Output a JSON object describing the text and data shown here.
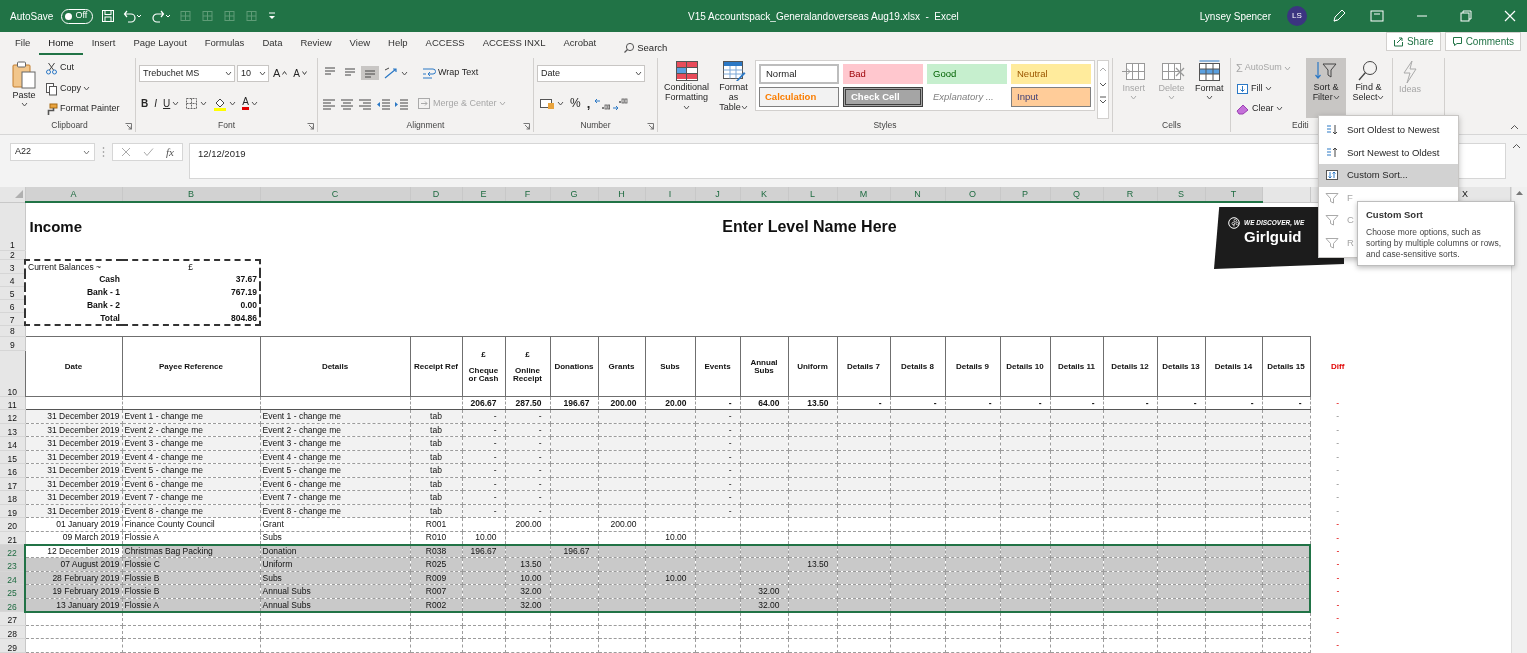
{
  "title_bar": {
    "autosave_label": "AutoSave",
    "autosave": {
      "label": "Off",
      "on": false
    },
    "document_title": "V15 Accountspack_Generalandoverseas Aug19.xlsx  -  Excel",
    "user_name": "Lynsey Spencer",
    "user_initials": "LS"
  },
  "ribbon_tabs": [
    {
      "label": "File",
      "selected": false
    },
    {
      "label": "Home",
      "selected": true
    },
    {
      "label": "Insert",
      "selected": false
    },
    {
      "label": "Page Layout",
      "selected": false
    },
    {
      "label": "Formulas",
      "selected": false
    },
    {
      "label": "Data",
      "selected": false
    },
    {
      "label": "Review",
      "selected": false
    },
    {
      "label": "View",
      "selected": false
    },
    {
      "label": "Help",
      "selected": false
    },
    {
      "label": "ACCESS",
      "selected": false
    },
    {
      "label": "ACCESS INXL",
      "selected": false
    },
    {
      "label": "Acrobat",
      "selected": false
    }
  ],
  "search_label": "Search",
  "share_label": "Share",
  "comments_label": "Comments",
  "ribbon": {
    "clipboard": {
      "label": "Clipboard",
      "paste": "Paste",
      "cut": "Cut",
      "copy": "Copy",
      "format_painter": "Format Painter"
    },
    "font": {
      "label": "Font",
      "font_name": "Trebuchet MS",
      "font_size": "10",
      "grow_font": "A",
      "shrink_font": "A",
      "bold": "B",
      "italic": "I",
      "underline": "U",
      "font_color": "A"
    },
    "alignment": {
      "label": "Alignment",
      "vertical_align": [
        {
          "selected": false
        },
        {
          "selected": false
        },
        {
          "selected": true
        }
      ],
      "wrap_text": "Wrap Text",
      "merge_center": {
        "label": "Merge & Center",
        "disabled": true
      }
    },
    "number": {
      "label": "Number",
      "format": "Date",
      "percent": "%",
      "comma": ","
    },
    "styles": {
      "label": "Styles",
      "conditional_formatting": "Conditional Formatting",
      "format_as_table": "Format as Table",
      "cell_styles": [
        {
          "label": "Normal",
          "kind": "normal"
        },
        {
          "label": "Bad",
          "kind": "bad"
        },
        {
          "label": "Good",
          "kind": "good"
        },
        {
          "label": "Neutral",
          "kind": "neutral"
        },
        {
          "label": "Calculation",
          "kind": "calculation"
        },
        {
          "label": "Check Cell",
          "kind": "check"
        },
        {
          "label": "Explanatory ...",
          "kind": "explanatory"
        },
        {
          "label": "Input",
          "kind": "input"
        }
      ]
    },
    "cells": {
      "label": "Cells",
      "buttons": [
        {
          "label": "Insert",
          "kind": "insert",
          "disabled": true
        },
        {
          "label": "Delete",
          "kind": "delete",
          "disabled": true
        },
        {
          "label": "Format",
          "kind": "format",
          "disabled": false
        }
      ]
    },
    "editing": {
      "label": "Editi",
      "autosum": {
        "symbol": "Σ",
        "label": "AutoSum",
        "disabled": true
      },
      "fill": "Fill",
      "clear": "Clear",
      "sort_filter": {
        "label": "Sort & Filter",
        "expanded": true
      },
      "find_select": "Find & Select"
    },
    "ideas": {
      "label": "Ideas",
      "disabled": true
    }
  },
  "sort_menu": {
    "items": [
      {
        "label": "Sort Oldest to Newest",
        "kind": "sort_ascending",
        "disabled": false,
        "selected": false
      },
      {
        "label": "Sort Newest to Oldest",
        "kind": "sort_descending",
        "disabled": false,
        "selected": false
      },
      {
        "label": "Custom Sort...",
        "kind": "custom",
        "disabled": false,
        "selected": true
      },
      {
        "label": "F",
        "kind": "filter",
        "disabled": true,
        "selected": false
      },
      {
        "label": "C",
        "kind": "clear_filter",
        "disabled": true,
        "selected": false
      },
      {
        "label": "R",
        "kind": "reapply",
        "disabled": true,
        "selected": false
      }
    ]
  },
  "tooltip": {
    "title": "Custom Sort",
    "text": "Choose more options, such as sorting by multiple columns or rows, and case-sensitive sorts."
  },
  "formula_bar": {
    "name_box": "A22",
    "function_symbol": "fx",
    "formula": "12/12/2019"
  },
  "sheet": {
    "column_headers": [
      {
        "kind": "letter",
        "letter": "A",
        "selected": true
      },
      {
        "kind": "letter",
        "letter": "B",
        "selected": true
      },
      {
        "kind": "letter",
        "letter": "C",
        "selected": true
      },
      {
        "kind": "letter",
        "letter": "D",
        "selected": true
      },
      {
        "kind": "letter",
        "letter": "E",
        "selected": true
      },
      {
        "kind": "letter",
        "letter": "F",
        "selected": true
      },
      {
        "kind": "letter",
        "letter": "G",
        "selected": true
      },
      {
        "kind": "letter",
        "letter": "H",
        "selected": true
      },
      {
        "kind": "letter",
        "letter": "I",
        "selected": true
      },
      {
        "kind": "letter",
        "letter": "J",
        "selected": true
      },
      {
        "kind": "letter",
        "letter": "K",
        "selected": true
      },
      {
        "kind": "letter",
        "letter": "L",
        "selected": true
      },
      {
        "kind": "letter",
        "letter": "M",
        "selected": true
      },
      {
        "kind": "letter",
        "letter": "N",
        "selected": true
      },
      {
        "kind": "letter",
        "letter": "O",
        "selected": true
      },
      {
        "kind": "letter",
        "letter": "P",
        "selected": true
      },
      {
        "kind": "letter",
        "letter": "Q",
        "selected": true
      },
      {
        "kind": "letter",
        "letter": "R",
        "selected": true
      },
      {
        "kind": "letter",
        "letter": "S",
        "selected": true
      },
      {
        "kind": "letter",
        "letter": "T",
        "selected": true
      },
      {
        "kind": "covered"
      },
      {
        "kind": "covered"
      },
      {
        "kind": "covered"
      },
      {
        "kind": "letter",
        "letter": "X",
        "selected": false
      }
    ],
    "row_numbers": [
      "1",
      "2",
      "3",
      "4",
      "5",
      "6",
      "7",
      "8",
      "9",
      "10",
      "11",
      "12",
      "13",
      "14",
      "15",
      "16",
      "17",
      "18",
      "19",
      "20",
      "21",
      "22",
      "23",
      "24",
      "25",
      "26",
      "27",
      "28",
      "29"
    ],
    "title": "Income",
    "heading": "Enter Level Name Here",
    "logo": {
      "tagline": "WE DISCOVER, WE",
      "name": "Girlguid"
    },
    "balances": {
      "title": "Current Balances ~",
      "currency": "£",
      "items": [
        {
          "label": "Cash",
          "value": "37.67"
        },
        {
          "label": "Bank - 1",
          "value": "767.19"
        },
        {
          "label": "Bank - 2",
          "value": "0.00"
        },
        {
          "label": "Total",
          "value": "804.86"
        }
      ]
    },
    "headers": [
      {
        "label": "Date",
        "kind": "column"
      },
      {
        "label": "Payee Reference",
        "kind": "column"
      },
      {
        "label": "Details",
        "kind": "column"
      },
      {
        "label": "Receipt Ref",
        "kind": "column"
      },
      {
        "label": "Cheque or Cash",
        "currency": "£",
        "kind": "column"
      },
      {
        "label": "Online Receipt",
        "currency": "£",
        "kind": "column"
      },
      {
        "label": "Donations",
        "kind": "column"
      },
      {
        "label": "Grants",
        "kind": "column"
      },
      {
        "label": "Subs",
        "kind": "column"
      },
      {
        "label": "Events",
        "kind": "column"
      },
      {
        "label": "Annual Subs",
        "kind": "column"
      },
      {
        "label": "Uniform",
        "kind": "column"
      },
      {
        "label": "Details 7",
        "kind": "column"
      },
      {
        "label": "Details 8",
        "kind": "column"
      },
      {
        "label": "Details 9",
        "kind": "column"
      },
      {
        "label": "Details 10",
        "kind": "column"
      },
      {
        "label": "Details 11",
        "kind": "column"
      },
      {
        "label": "Details 12",
        "kind": "column"
      },
      {
        "label": "Details 13",
        "kind": "column"
      },
      {
        "label": "Details 14",
        "kind": "column"
      },
      {
        "label": "Details 15",
        "kind": "column"
      },
      {
        "label": "Diff",
        "kind": "diff"
      }
    ],
    "totals": [
      "206.67",
      "287.50",
      "196.67",
      "200.00",
      "20.00",
      "-",
      "64.00",
      "13.50",
      "-",
      "-",
      "-",
      "-",
      "-",
      "-",
      "-",
      "-",
      "-"
    ],
    "totals_diff": {
      "value": "-",
      "alert": true
    },
    "entries": [
      {
        "kind": "template",
        "date": "31 December 2019",
        "payee": "Event 1 - change me",
        "details": "Event 1 - change me",
        "ref": "tab",
        "values": {
          "cheque_or_cash": "-",
          "online_receipt": "-",
          "events": "-"
        },
        "diff": "-",
        "diff_alert": false,
        "selected": false,
        "active": false
      },
      {
        "kind": "template",
        "date": "31 December 2019",
        "payee": "Event 2 - change me",
        "details": "Event 2 - change me",
        "ref": "tab",
        "values": {
          "cheque_or_cash": "-",
          "online_receipt": "-",
          "events": "-"
        },
        "diff": "-",
        "diff_alert": false,
        "selected": false,
        "active": false
      },
      {
        "kind": "template",
        "date": "31 December 2019",
        "payee": "Event 3 - change me",
        "details": "Event 3 - change me",
        "ref": "tab",
        "values": {
          "cheque_or_cash": "-",
          "online_receipt": "-",
          "events": "-"
        },
        "diff": "-",
        "diff_alert": false,
        "selected": false,
        "active": false
      },
      {
        "kind": "template",
        "date": "31 December 2019",
        "payee": "Event 4 - change me",
        "details": "Event 4 - change me",
        "ref": "tab",
        "values": {
          "cheque_or_cash": "-",
          "online_receipt": "-",
          "events": "-"
        },
        "diff": "-",
        "diff_alert": false,
        "selected": false,
        "active": false
      },
      {
        "kind": "template",
        "date": "31 December 2019",
        "payee": "Event 5 - change me",
        "details": "Event 5 - change me",
        "ref": "tab",
        "values": {
          "cheque_or_cash": "-",
          "online_receipt": "-",
          "events": "-"
        },
        "diff": "-",
        "diff_alert": false,
        "selected": false,
        "active": false
      },
      {
        "kind": "template",
        "date": "31 December 2019",
        "payee": "Event 6 - change me",
        "details": "Event 6 - change me",
        "ref": "tab",
        "values": {
          "cheque_or_cash": "-",
          "online_receipt": "-",
          "events": "-"
        },
        "diff": "-",
        "diff_alert": false,
        "selected": false,
        "active": false
      },
      {
        "kind": "template",
        "date": "31 December 2019",
        "payee": "Event 7 - change me",
        "details": "Event 7 - change me",
        "ref": "tab",
        "values": {
          "cheque_or_cash": "-",
          "online_receipt": "-",
          "events": "-"
        },
        "diff": "-",
        "diff_alert": false,
        "selected": false,
        "active": false
      },
      {
        "kind": "template",
        "date": "31 December 2019",
        "payee": "Event 8 - change me",
        "details": "Event 8 - change me",
        "ref": "tab",
        "values": {
          "cheque_or_cash": "-",
          "online_receipt": "-",
          "events": "-"
        },
        "diff": "-",
        "diff_alert": false,
        "selected": false,
        "active": false
      },
      {
        "kind": "entry",
        "date": "01 January 2019",
        "payee": "Finance County Council",
        "details": "Grant",
        "ref": "R001",
        "values": {
          "online_receipt": "200.00",
          "grants": "200.00"
        },
        "diff": "-",
        "diff_alert": true,
        "selected": false,
        "active": false
      },
      {
        "kind": "entry",
        "date": "09 March 2019",
        "payee": "Flossie A",
        "details": "Subs",
        "ref": "R010",
        "values": {
          "cheque_or_cash": "10.00",
          "subs": "10.00"
        },
        "diff": "-",
        "diff_alert": true,
        "selected": false,
        "active": false
      },
      {
        "kind": "entry",
        "date": "12 December 2019",
        "payee": "Christmas Bag Packing",
        "details": "Donation",
        "ref": "R038",
        "values": {
          "cheque_or_cash": "196.67",
          "donations": "196.67"
        },
        "diff": "-",
        "diff_alert": true,
        "selected": true,
        "active": true
      },
      {
        "kind": "entry",
        "date": "07 August 2019",
        "payee": "Flossie C",
        "details": "Uniform",
        "ref": "R025",
        "values": {
          "online_receipt": "13.50",
          "uniform": "13.50"
        },
        "diff": "-",
        "diff_alert": true,
        "selected": true,
        "active": false
      },
      {
        "kind": "entry",
        "date": "28 February 2019",
        "payee": "Flossie B",
        "details": "Subs",
        "ref": "R009",
        "values": {
          "online_receipt": "10.00",
          "subs": "10.00"
        },
        "diff": "-",
        "diff_alert": true,
        "selected": true,
        "active": false
      },
      {
        "kind": "entry",
        "date": "19 February 2019",
        "payee": "Flossie B",
        "details": "Annual Subs",
        "ref": "R007",
        "values": {
          "online_receipt": "32.00",
          "annual_subs": "32.00"
        },
        "diff": "-",
        "diff_alert": true,
        "selected": true,
        "active": false
      },
      {
        "kind": "entry",
        "date": "13 January 2019",
        "payee": "Flossie A",
        "details": "Annual Subs",
        "ref": "R002",
        "values": {
          "online_receipt": "32.00",
          "annual_subs": "32.00"
        },
        "diff": "-",
        "diff_alert": true,
        "selected": true,
        "active": false
      },
      {
        "kind": "blank",
        "diff": "-",
        "diff_alert": true,
        "selected": false,
        "active": false
      },
      {
        "kind": "blank",
        "diff": "-",
        "diff_alert": true,
        "selected": false,
        "active": false
      },
      {
        "kind": "blank",
        "diff": "-",
        "diff_alert": true,
        "selected": false,
        "active": false
      }
    ]
  }
}
